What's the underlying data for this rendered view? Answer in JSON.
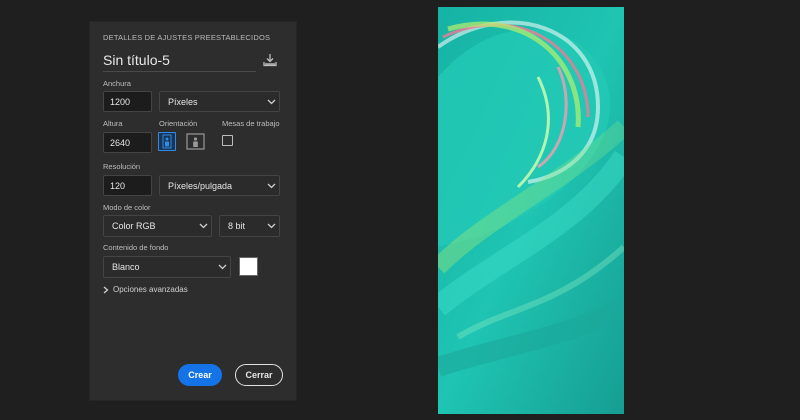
{
  "panel": {
    "section_title": "DETALLES DE AJUSTES PREESTABLECIDOS",
    "doc_title": "Sin título-5",
    "save_preset_icon": "download-icon",
    "width": {
      "label": "Anchura",
      "value": "1200",
      "unit": "Píxeles"
    },
    "height": {
      "label": "Altura",
      "value": "2640"
    },
    "orientation": {
      "label": "Orientación",
      "selected": "portrait",
      "icons": [
        "portrait-icon",
        "landscape-icon"
      ]
    },
    "artboards": {
      "label": "Mesas de trabajo",
      "checked": false
    },
    "resolution": {
      "label": "Resolución",
      "value": "120",
      "unit": "Píxeles/pulgada"
    },
    "color_mode": {
      "label": "Modo de color",
      "value": "Color RGB",
      "bits": "8 bit"
    },
    "background": {
      "label": "Contenido de fondo",
      "value": "Blanco",
      "swatch_color": "#ffffff"
    },
    "advanced": {
      "label": "Opciones avanzadas"
    },
    "buttons": {
      "create": "Crear",
      "close": "Cerrar"
    }
  },
  "colors": {
    "accent": "#1473e6",
    "panel_bg": "#2d2d2d",
    "app_bg": "#1f1f1f"
  }
}
